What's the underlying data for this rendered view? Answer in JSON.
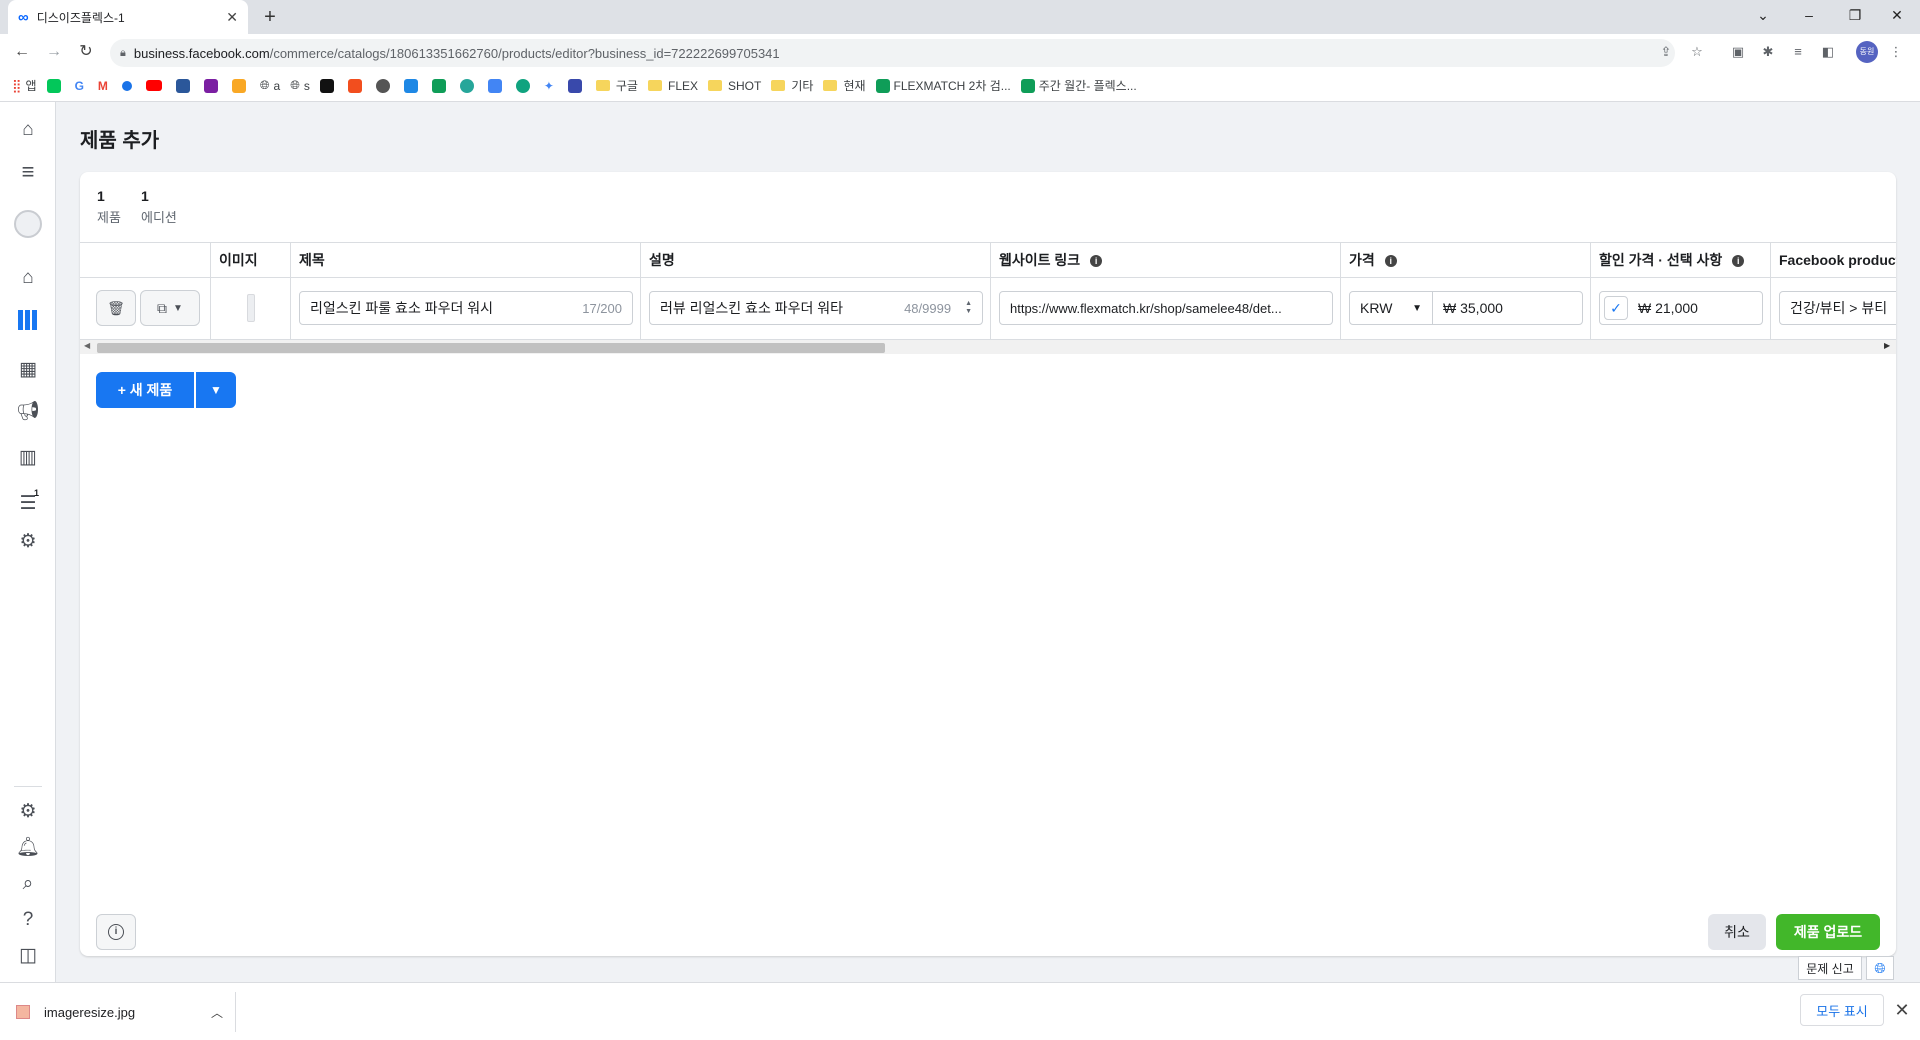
{
  "browser": {
    "tab_title": "디스이즈플렉스-1",
    "tab_close": "✕",
    "new_tab": "+",
    "url_host": "business.facebook.com",
    "url_path": "/commerce/catalogs/180613351662760/products/editor?business_id=722222699705341",
    "avatar_text": "동원",
    "bookmarks": [
      "앱",
      "a",
      "s",
      "구글",
      "FLEX",
      "SHOT",
      "기타",
      "현재",
      "FLEXMATCH 2차 검...",
      "주간 월간- 플렉스..."
    ]
  },
  "page": {
    "title": "제품 추가",
    "stats": [
      {
        "value": "1",
        "label": "제품"
      },
      {
        "value": "1",
        "label": "에디션"
      }
    ]
  },
  "table": {
    "columns": {
      "image": "이미지",
      "title": "제목",
      "description": "설명",
      "link": "웹사이트 링크",
      "price": "가격",
      "sale_price": "할인 가격 · 선택 사항",
      "fb_category": "Facebook product c"
    },
    "row": {
      "title": "리얼스킨 파룰 효소 파우더 워시",
      "title_count": "17/200",
      "description": "러뷰 리얼스킨 효소 파우더 워타",
      "description_count": "48/9999",
      "link": "https://www.flexmatch.kr/shop/samelee48/det...",
      "currency": "KRW",
      "price": "₩ 35,000",
      "sale_price": "₩ 21,000",
      "fb_category": "건강/뷰티 > 뷰티"
    }
  },
  "buttons": {
    "new_product": "+ 새 제품",
    "cancel": "취소",
    "upload": "제품 업로드",
    "report": "문제 신고"
  },
  "nav_badge": "1",
  "download": {
    "filename": "imageresize.jpg",
    "show_all": "모두 표시"
  }
}
